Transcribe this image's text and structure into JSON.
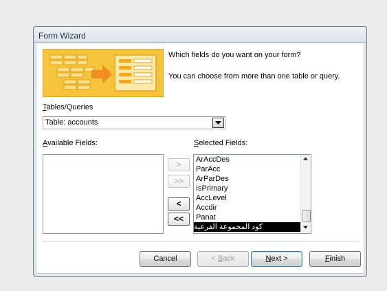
{
  "window": {
    "title": "Form Wizard"
  },
  "intro": {
    "question": "Which fields do you want on your form?",
    "hint": "You can choose from more than one table or query."
  },
  "tables_queries": {
    "label_mnemonic": "T",
    "label_rest": "ables/Queries",
    "value": "Table: accounts"
  },
  "available_fields": {
    "label_mnemonic": "A",
    "label_rest": "vailable Fields:",
    "items": []
  },
  "selected_fields": {
    "label_mnemonic": "S",
    "label_rest": "elected Fields:",
    "items": [
      "ArAccDes",
      "ParAcc",
      "ArParDes",
      "IsPrimary",
      "AccLevel",
      "Accdir",
      "Panat",
      "كود المجموعة الفرعية"
    ],
    "selected_index": 7
  },
  "move_buttons": {
    "add_one": ">",
    "add_all": ">>",
    "remove_one": "<",
    "remove_all": "<<"
  },
  "buttons": {
    "cancel": "Cancel",
    "back_mnemonic": "B",
    "back_prefix": "< ",
    "back_rest": "ack",
    "next_mnemonic": "N",
    "next_rest": "ext >",
    "finish_mnemonic": "F",
    "finish_rest": "inish"
  },
  "colors": {
    "wizard_image_bg": "#f6c43a",
    "selection_bg": "#000000"
  }
}
